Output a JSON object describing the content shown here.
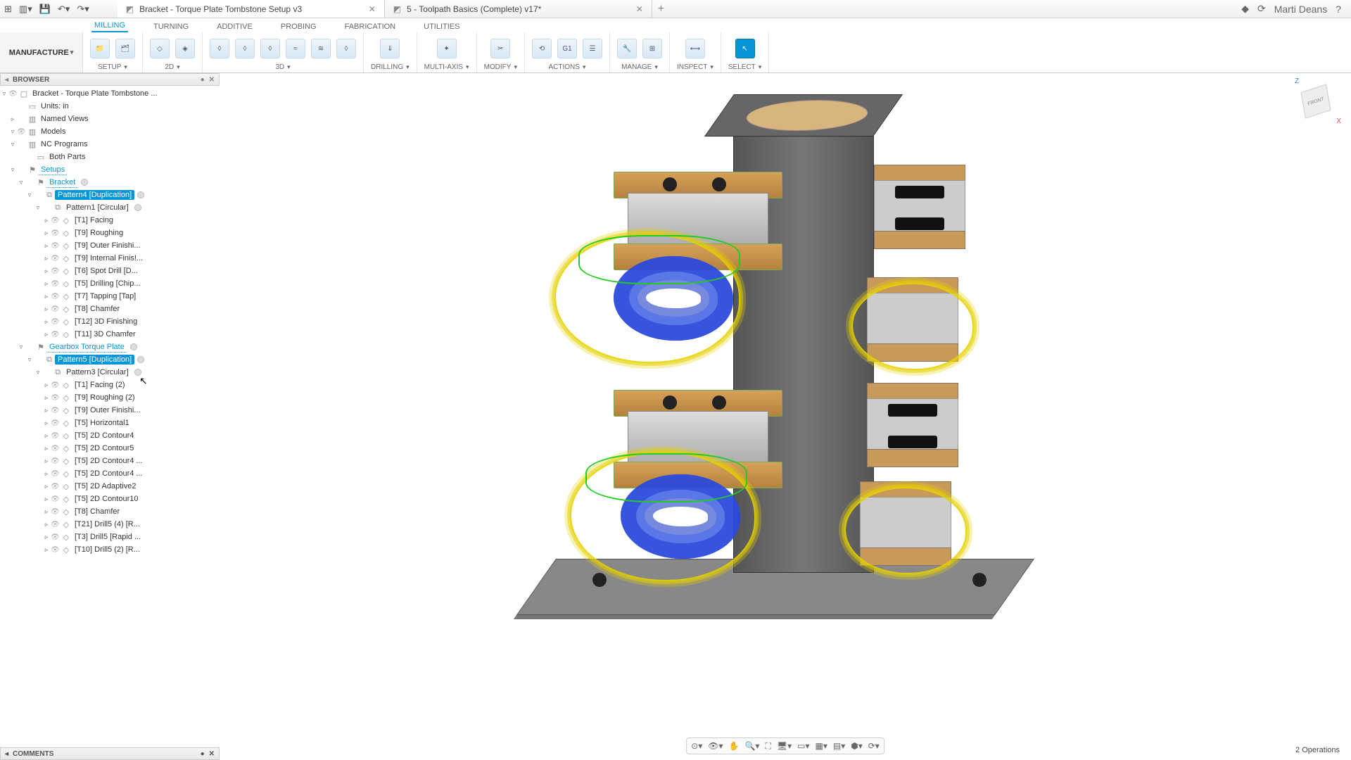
{
  "topbar": {
    "qat_icons": [
      "apps",
      "file",
      "save",
      "undo",
      "redo"
    ],
    "tabs": [
      {
        "title": "Bracket - Torque Plate Tombstone Setup v3",
        "active": true
      },
      {
        "title": "5 - Toolpath Basics (Complete) v17*",
        "active": false
      }
    ],
    "user": "Marti Deans"
  },
  "workspace": "MANUFACTURE",
  "ribbon_tabs": [
    "MILLING",
    "TURNING",
    "ADDITIVE",
    "PROBING",
    "FABRICATION",
    "UTILITIES"
  ],
  "ribbon_active": "MILLING",
  "ribbon_groups": [
    {
      "label": "SETUP",
      "dropdown": true,
      "icons": 2
    },
    {
      "label": "2D",
      "dropdown": true,
      "icons": 2
    },
    {
      "label": "3D",
      "dropdown": true,
      "icons": 6
    },
    {
      "label": "DRILLING",
      "dropdown": true,
      "icons": 1
    },
    {
      "label": "MULTI-AXIS",
      "dropdown": true,
      "icons": 1
    },
    {
      "label": "MODIFY",
      "dropdown": true,
      "icons": 1
    },
    {
      "label": "ACTIONS",
      "dropdown": true,
      "icons": 3
    },
    {
      "label": "MANAGE",
      "dropdown": true,
      "icons": 2
    },
    {
      "label": "INSPECT",
      "dropdown": true,
      "icons": 1
    },
    {
      "label": "SELECT",
      "dropdown": true,
      "icons": 1,
      "selected": true
    }
  ],
  "browser": {
    "title": "BROWSER",
    "root": "Bracket - Torque Plate Tombstone ...",
    "units": "Units: in",
    "named_views": "Named Views",
    "models": "Models",
    "nc_programs": "NC Programs",
    "both_parts": "Both Parts",
    "setups": "Setups",
    "bracket": "Bracket",
    "pattern4": "Pattern4 [Duplication]",
    "pattern1": "Pattern1 [Circular]",
    "ops1": [
      "[T1] Facing",
      "[T9] Roughing",
      "[T9] Outer Finishi...",
      "[T9] Internal Finis!...",
      "[T6] Spot Drill [D...",
      "[T5] Drilling [Chip...",
      "[T7] Tapping [Tap]",
      "[T8] Chamfer",
      "[T12] 3D Finishing",
      "[T11] 3D Chamfer"
    ],
    "gearbox": "Gearbox Torque Plate",
    "pattern5": "Pattern5 [Duplication]",
    "pattern3": "Pattern3 [Circular]",
    "ops2": [
      "[T1] Facing (2)",
      "[T9] Roughing (2)",
      "[T9] Outer Finishi...",
      "[T5] Horizontal1",
      "[T5] 2D Contour4",
      "[T5] 2D Contour5",
      "[T5] 2D Contour4 ...",
      "[T5] 2D Contour4 ...",
      "[T5] 2D Adaptive2",
      "[T5] 2D Contour10",
      "[T8] Chamfer",
      "[T21] Drill5 (4) [R...",
      "[T3] Drill5 [Rapid ...",
      "[T10] Drill5 (2) [R..."
    ]
  },
  "comments": "COMMENTS",
  "status": "2 Operations",
  "viewcube": {
    "face": "FRONT",
    "z": "Z",
    "x": "X"
  }
}
